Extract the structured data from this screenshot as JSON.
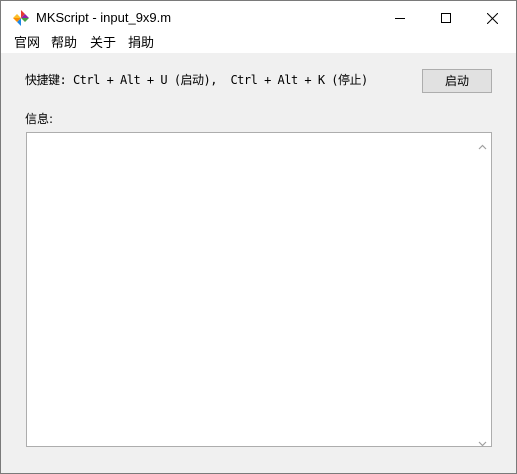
{
  "window": {
    "title": "MKScript - input_9x9.m",
    "icon": "pinwheel-icon"
  },
  "menu": [
    "官网",
    "帮助",
    "关于",
    "捐助"
  ],
  "main": {
    "hotkey_text": "快捷键: Ctrl + Alt + U (启动),  Ctrl + Alt + K (停止)",
    "start_button": "启动",
    "info_label": "信息:",
    "info_content": ""
  },
  "colors": {
    "window_bg": "#f0f0f0",
    "titlebar_bg": "#ffffff",
    "button_bg": "#e1e1e1",
    "button_border": "#adadad"
  }
}
